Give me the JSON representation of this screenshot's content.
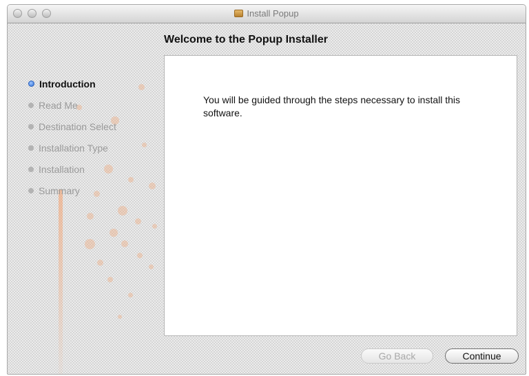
{
  "window": {
    "title": "Install Popup",
    "title_icon": "package-icon"
  },
  "main": {
    "heading": "Welcome to the Popup Installer",
    "body": "You will be guided through the steps necessary to install this software."
  },
  "steps": [
    {
      "label": "Introduction",
      "state": "current"
    },
    {
      "label": "Read Me",
      "state": "pending"
    },
    {
      "label": "Destination Select",
      "state": "pending"
    },
    {
      "label": "Installation Type",
      "state": "pending"
    },
    {
      "label": "Installation",
      "state": "pending"
    },
    {
      "label": "Summary",
      "state": "pending"
    }
  ],
  "buttons": {
    "back": {
      "label": "Go Back",
      "enabled": false
    },
    "continue": {
      "label": "Continue",
      "enabled": true
    }
  },
  "colors": {
    "current_step_bullet": "#2f6fd6",
    "sidebar_art": "#f0a06e"
  }
}
